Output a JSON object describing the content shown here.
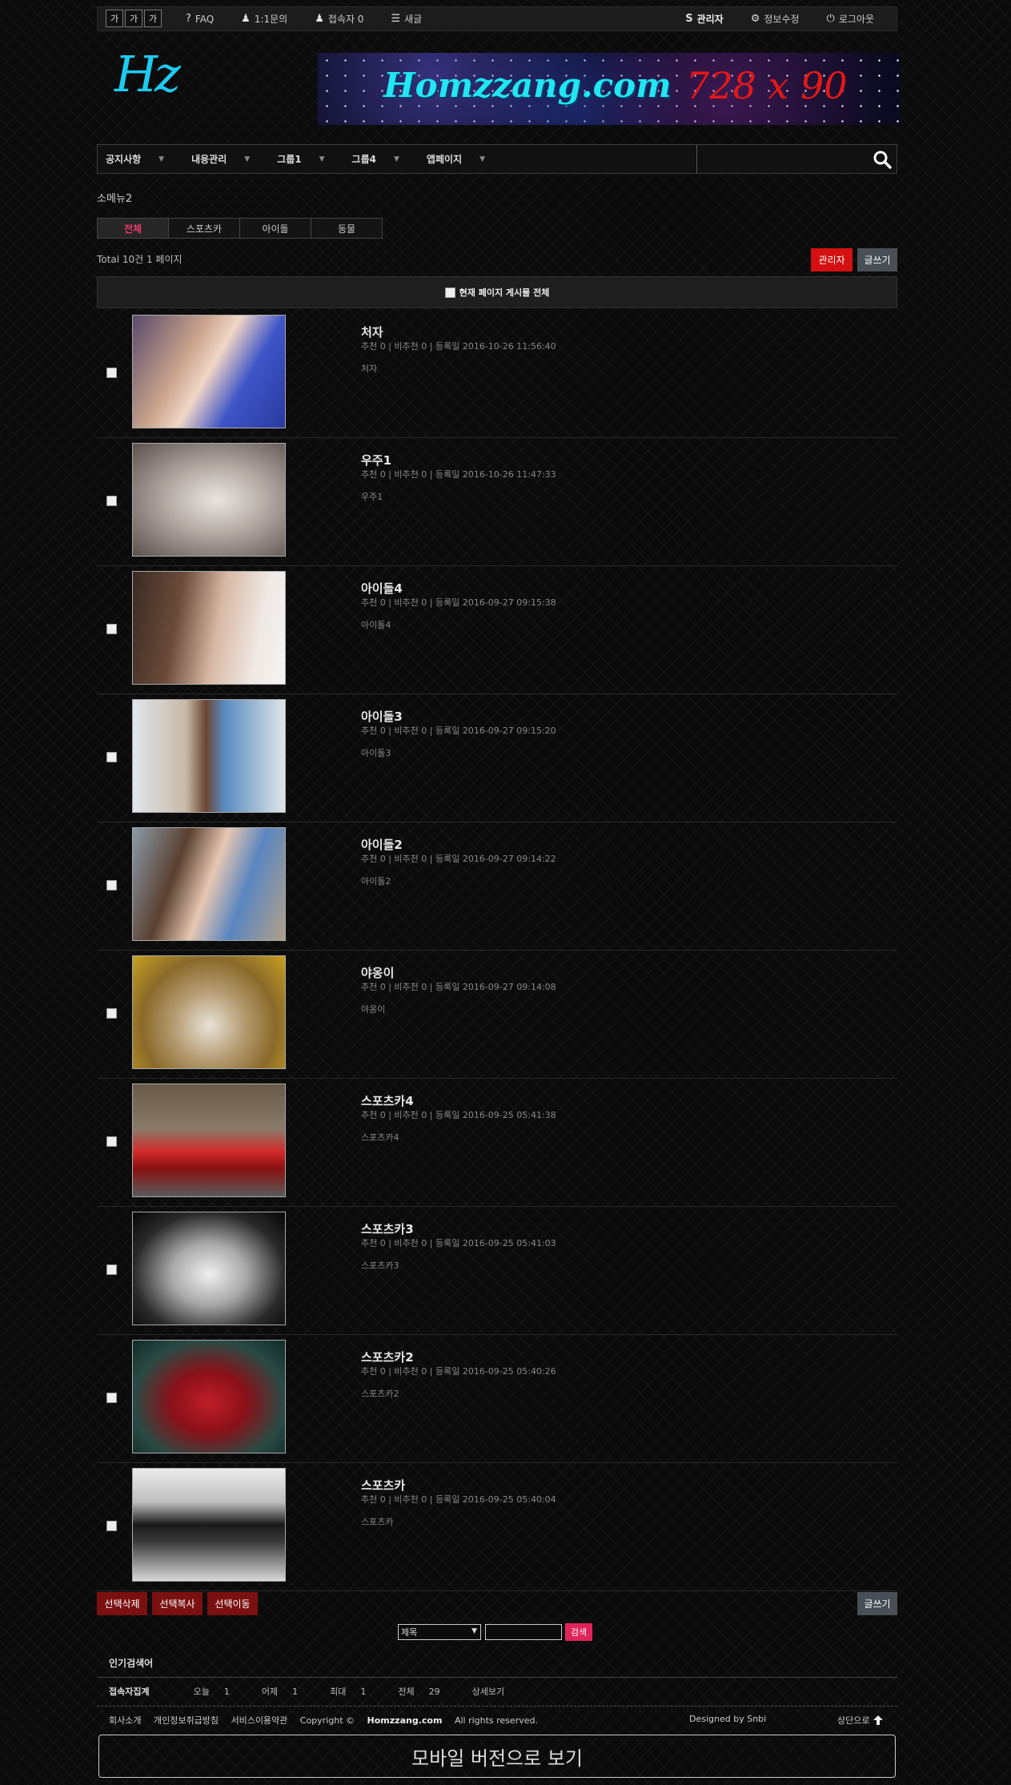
{
  "topbar": {
    "font_sizes": [
      "가",
      "가",
      "가"
    ],
    "links": [
      {
        "icon": "question-icon",
        "label": "FAQ"
      },
      {
        "icon": "user-icon",
        "label": "1:1문의"
      },
      {
        "icon": "user-icon",
        "label": "접속자 0"
      },
      {
        "icon": "list-icon",
        "label": "새글"
      }
    ],
    "right_links": [
      {
        "icon": "s-logo-icon",
        "label": "관리자"
      },
      {
        "icon": "gear-icon",
        "label": "정보수정"
      },
      {
        "icon": "power-icon",
        "label": "로그아웃"
      }
    ]
  },
  "header": {
    "logo": "Hz",
    "banner_site": "Homzzang.com",
    "banner_size": "728 x 90"
  },
  "nav": {
    "items": [
      "공지사항",
      "내용관리",
      "그룹1",
      "그룹4",
      "앱페이지"
    ],
    "search_placeholder": ""
  },
  "board": {
    "title": "소메뉴2",
    "tabs": [
      "전체",
      "스포츠카",
      "아이돌",
      "동물"
    ],
    "active_tab": "전체",
    "total": "Total 10건 1 페이지",
    "admin_button": "관리자",
    "write_button": "글쓰기",
    "select_all": "현재 페이지 게시물 전체",
    "posts": [
      {
        "title": "처자",
        "meta": "추천 0 | 비추천 0 | 등록일 2016-10-26 11:56:40",
        "desc": "처자",
        "thumb": "photo-woman-blue-sweater"
      },
      {
        "title": "우주1",
        "meta": "추천 0 | 비추천 0 | 등록일 2016-10-26 11:47:33",
        "desc": "우주1",
        "thumb": "photo-woman-white-top"
      },
      {
        "title": "아이돌4",
        "meta": "추천 0 | 비추천 0 | 등록일 2016-09-27 09:15:38",
        "desc": "아이돌4",
        "thumb": "photo-woman-brown-hair"
      },
      {
        "title": "아이돌3",
        "meta": "추천 0 | 비추천 0 | 등록일 2016-09-27 09:15:20",
        "desc": "아이돌3",
        "thumb": "photo-woman-winter-hat"
      },
      {
        "title": "아이돌2",
        "meta": "추천 0 | 비추천 0 | 등록일 2016-09-27 09:14:22",
        "desc": "아이돌2",
        "thumb": "photo-woman-hat-denim"
      },
      {
        "title": "야옹이",
        "meta": "추천 0 | 비추천 0 | 등록일 2016-09-27 09:14:08",
        "desc": "야옹이",
        "thumb": "photo-cat-bear-hat"
      },
      {
        "title": "스포츠카4",
        "meta": "추천 0 | 비추천 0 | 등록일 2016-09-25 05:41:38",
        "desc": "스포츠카4",
        "thumb": "photo-red-lamborghini"
      },
      {
        "title": "스포츠카3",
        "meta": "추천 0 | 비추천 0 | 등록일 2016-09-25 05:41:03",
        "desc": "스포츠카3",
        "thumb": "photo-silver-concept-car"
      },
      {
        "title": "스포츠카2",
        "meta": "추천 0 | 비추천 0 | 등록일 2016-09-25 05:40:26",
        "desc": "스포츠카2",
        "thumb": "photo-red-audi"
      },
      {
        "title": "스포츠카",
        "meta": "추천 0 | 비추천 0 | 등록일 2016-09-25 05:40:04",
        "desc": "스포츠카",
        "thumb": "photo-black-sports-car"
      }
    ],
    "bottom_buttons": [
      "선택삭제",
      "선택복사",
      "선택이동"
    ],
    "bottom_write": "글쓰기"
  },
  "search": {
    "field_option": "제목",
    "query": "",
    "button": "검색"
  },
  "popular": {
    "title": "인기검색어"
  },
  "stats": {
    "label": "접속자집계",
    "items": [
      {
        "label": "오늘",
        "value": "1"
      },
      {
        "label": "어제",
        "value": "1"
      },
      {
        "label": "최대",
        "value": "1"
      },
      {
        "label": "전체",
        "value": "29"
      }
    ],
    "detail": "상세보기"
  },
  "footer": {
    "links": [
      "회사소개",
      "개인정보취급방침",
      "서비스이용약관"
    ],
    "copyright_prefix": "Copyright ©",
    "copyright_brand": "Homzzang.com",
    "copyright_suffix": "All rights reserved.",
    "designed": "Designed by Snbi",
    "to_top": "상단으로"
  },
  "mobile_view": "모바일 버전으로 보기",
  "colors": {
    "accent": "#e0245a",
    "admin_red": "#d41010",
    "logo_cyan": "#1ecbf0"
  }
}
